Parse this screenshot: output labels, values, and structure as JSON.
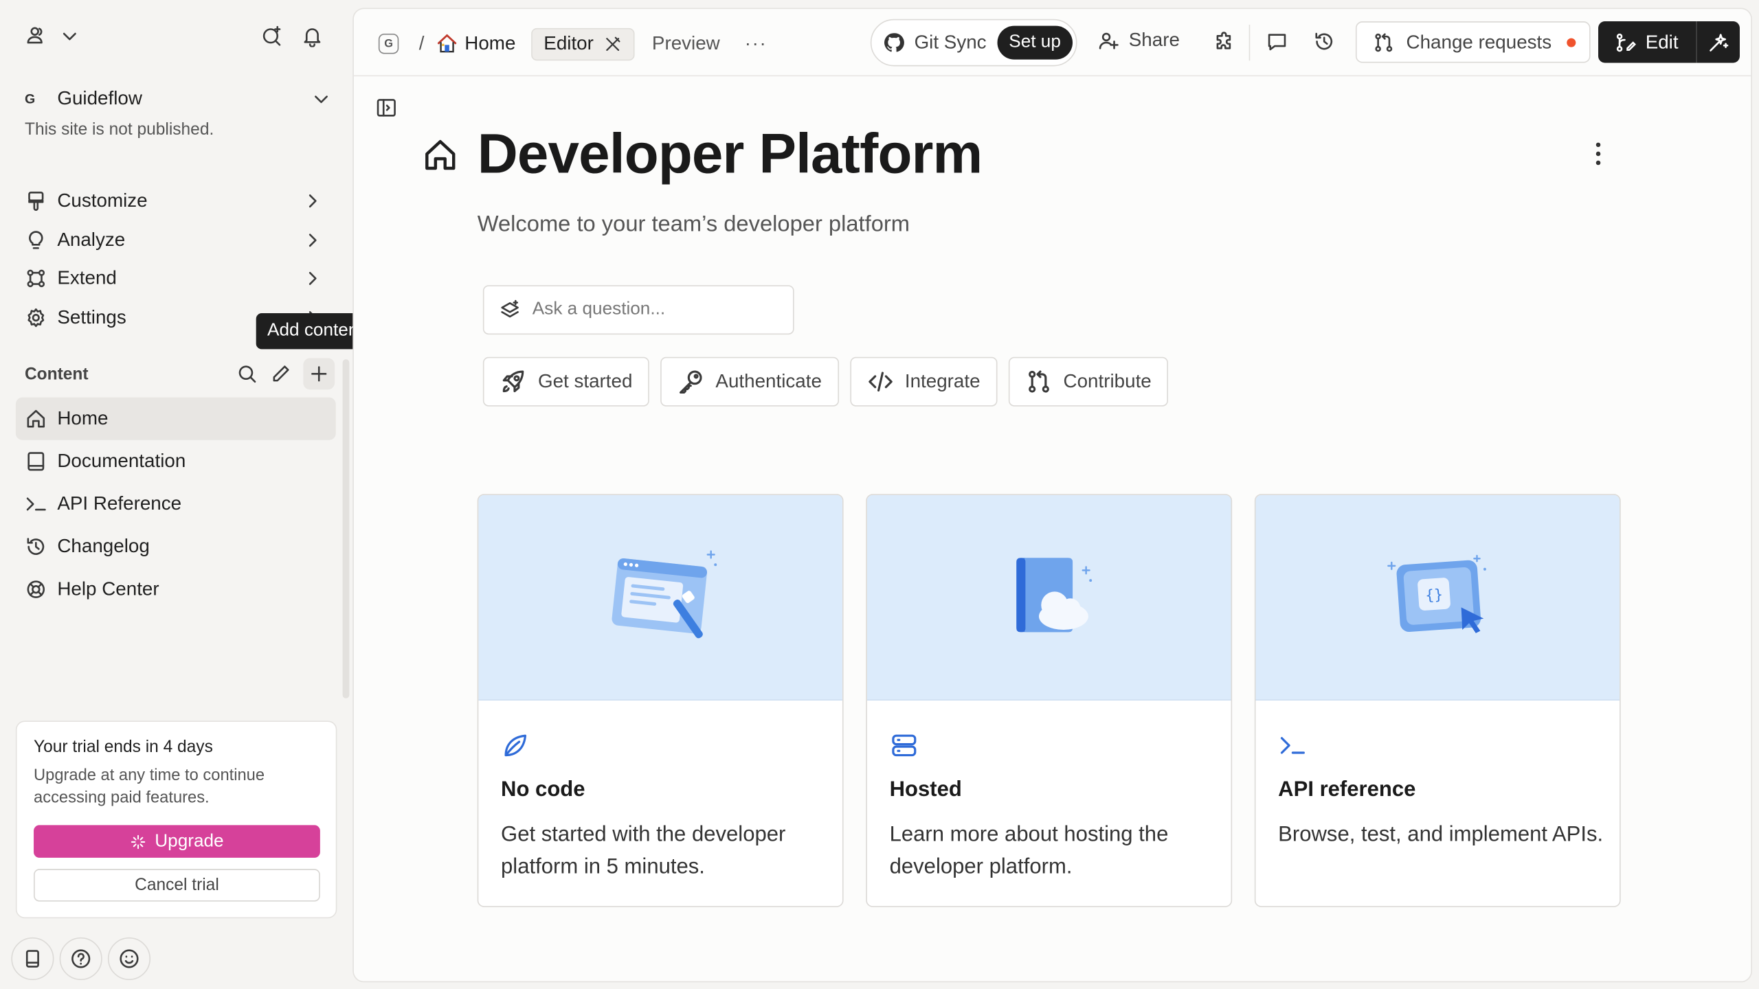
{
  "sidebar": {
    "site": {
      "logo_letter": "G",
      "name": "Guideflow",
      "status": "This site is not published."
    },
    "nav": [
      {
        "label": "Customize",
        "icon": "paint-brush-icon"
      },
      {
        "label": "Analyze",
        "icon": "lightbulb-icon"
      },
      {
        "label": "Extend",
        "icon": "integrations-icon"
      },
      {
        "label": "Settings",
        "icon": "gear-icon"
      }
    ],
    "content_label": "Content",
    "tooltip": "Add content",
    "pages": [
      {
        "label": "Home",
        "icon": "home-icon",
        "active": true
      },
      {
        "label": "Documentation",
        "icon": "book-icon",
        "active": false
      },
      {
        "label": "API Reference",
        "icon": "terminal-icon",
        "active": false
      },
      {
        "label": "Changelog",
        "icon": "history-icon",
        "active": false
      },
      {
        "label": "Help Center",
        "icon": "lifebuoy-icon",
        "active": false
      }
    ],
    "trial": {
      "title": "Your trial ends in 4 days",
      "text": "Upgrade at any time to continue accessing paid features.",
      "upgrade_label": "Upgrade",
      "cancel_label": "Cancel trial"
    }
  },
  "topbar": {
    "space_badge": "G",
    "breadcrumb_sep": "/",
    "breadcrumb_home": "Home",
    "tab_editor": "Editor",
    "tab_preview": "Preview",
    "more": "···",
    "git_sync": "Git Sync",
    "git_setup": "Set up",
    "share": "Share",
    "change_requests": "Change requests",
    "edit": "Edit"
  },
  "page": {
    "title": "Developer Platform",
    "description": "Welcome to your team’s developer platform",
    "ask_placeholder": "Ask a question...",
    "quick_links": [
      {
        "label": "Get started",
        "icon": "rocket-icon"
      },
      {
        "label": "Authenticate",
        "icon": "key-icon"
      },
      {
        "label": "Integrate",
        "icon": "code-icon"
      },
      {
        "label": "Contribute",
        "icon": "git-pull-request-icon"
      }
    ],
    "cards": [
      {
        "title": "No code",
        "text": "Get started with the developer platform in 5 minutes.",
        "icon": "leaf-icon",
        "illustration": "editor-window-pen"
      },
      {
        "title": "Hosted",
        "text": "Learn more about hosting the developer platform.",
        "icon": "server-icon",
        "illustration": "book-cloud"
      },
      {
        "title": "API reference",
        "text": "Browse, test, and implement APIs.",
        "icon": "terminal-icon",
        "illustration": "code-window-cursor"
      }
    ]
  },
  "colors": {
    "accent_upgrade": "#d6419a",
    "card_illustration_bg": "#dcebfb",
    "card_icon": "#2f6bd8",
    "notification_dot": "#f0532d"
  }
}
